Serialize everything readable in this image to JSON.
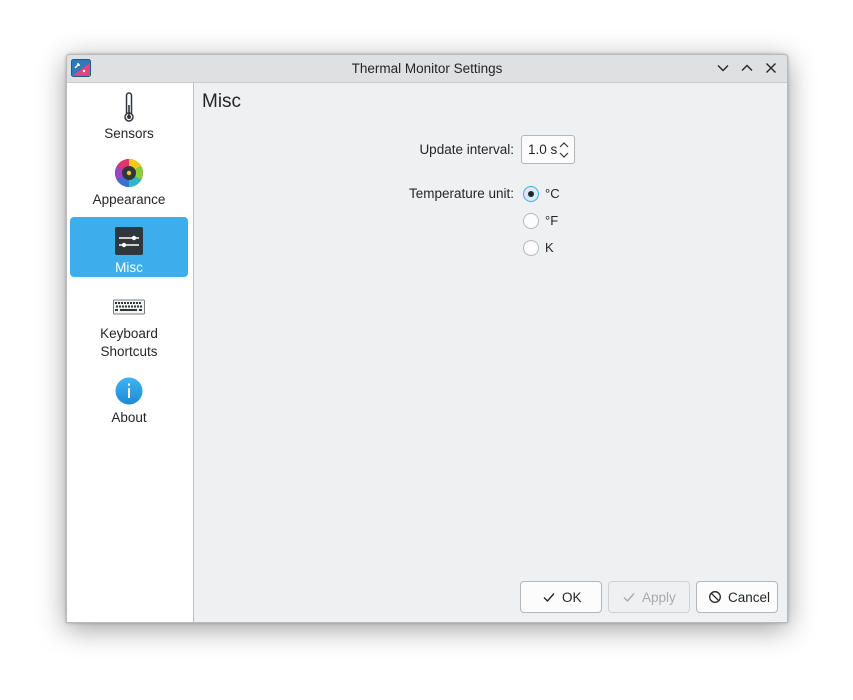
{
  "window": {
    "title": "Thermal Monitor Settings"
  },
  "titlebar": {
    "buttons": [
      "minimize",
      "maximize",
      "close"
    ]
  },
  "sidebar": {
    "items": [
      {
        "label": "Sensors",
        "icon": "thermometer-icon",
        "active": false
      },
      {
        "label": "Appearance",
        "icon": "color-wheel-icon",
        "active": false
      },
      {
        "label": "Misc",
        "icon": "sliders-icon",
        "active": true
      },
      {
        "label": "Keyboard\nShortcuts",
        "icon": "keyboard-icon",
        "active": false
      },
      {
        "label": "About",
        "icon": "info-icon",
        "active": false
      }
    ]
  },
  "main": {
    "title": "Misc",
    "update_interval": {
      "label": "Update interval:",
      "value": "1.0 s"
    },
    "temperature_unit": {
      "label": "Temperature unit:",
      "options": [
        {
          "label": "°C",
          "checked": true
        },
        {
          "label": "°F",
          "checked": false
        },
        {
          "label": "K",
          "checked": false
        }
      ]
    }
  },
  "buttons": {
    "ok": "OK",
    "apply": "Apply",
    "cancel": "Cancel"
  },
  "colors": {
    "accent": "#3daee9",
    "window_bg": "#eff0f1",
    "titlebar_bg": "#dee0e2",
    "text": "#232629"
  }
}
